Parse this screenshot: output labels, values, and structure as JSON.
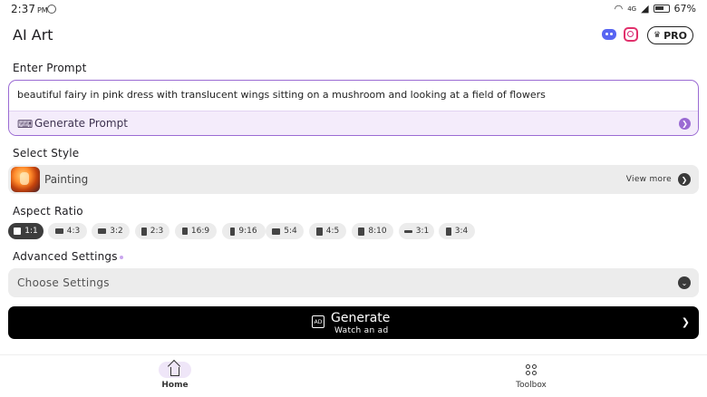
{
  "status_bar": {
    "time": "2:37",
    "ampm": "PM",
    "network": "4G",
    "battery": "67%"
  },
  "header": {
    "title": "AI Art",
    "pro_label": "PRO",
    "icons": [
      "discord-icon",
      "instagram-icon",
      "crown-icon"
    ]
  },
  "prompt": {
    "section_label": "Enter Prompt",
    "value": "beautiful fairy in pink dress with translucent wings sitting on a mushroom and looking at a field of flowers",
    "generate_label": "Generate Prompt"
  },
  "style": {
    "section_label": "Select Style",
    "selected": "Painting",
    "view_more": "View more"
  },
  "aspect_ratio": {
    "section_label": "Aspect Ratio",
    "selected": "1:1",
    "options": [
      "1:1",
      "4:3",
      "3:2",
      "2:3",
      "16:9",
      "9:16",
      "5:4",
      "4:5",
      "8:10",
      "3:1",
      "3:4"
    ]
  },
  "advanced": {
    "section_label": "Advanced Settings",
    "placeholder": "Choose Settings"
  },
  "generate": {
    "title": "Generate",
    "subtitle": "Watch an ad"
  },
  "bottom_nav": {
    "items": [
      {
        "label": "Home",
        "active": true
      },
      {
        "label": "Toolbox",
        "active": false
      }
    ]
  },
  "colors": {
    "accent": "#9b6bd3",
    "accent_light": "#f4ecfb",
    "chip_active": "#3d3d3d",
    "button_dark": "#000000"
  }
}
